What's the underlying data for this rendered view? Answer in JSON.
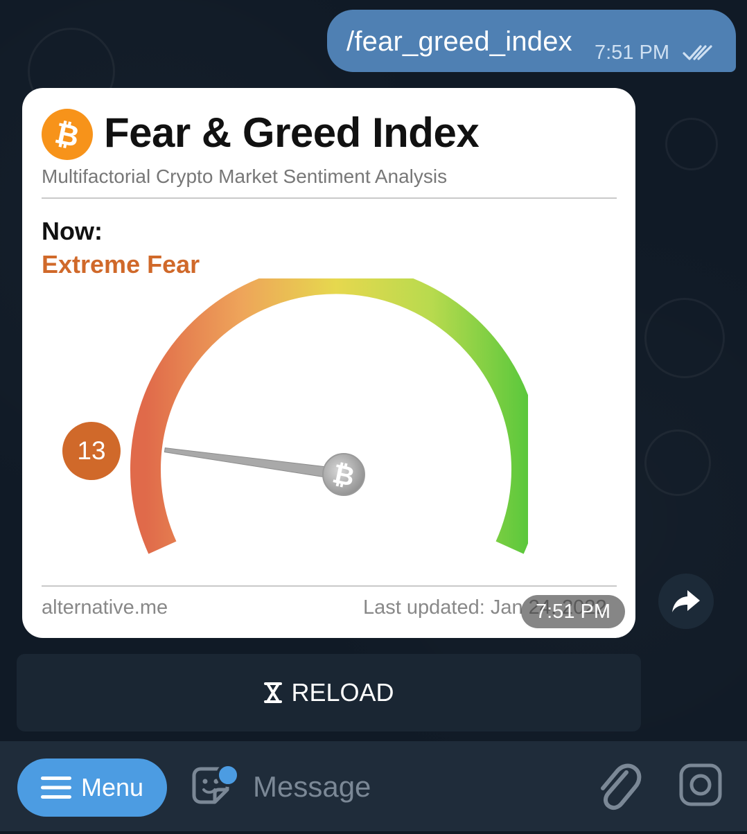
{
  "messages": {
    "outgoing": {
      "text": "/fear_greed_index",
      "time": "7:51 PM"
    },
    "incoming_image": {
      "title": "Fear & Greed Index",
      "subtitle": "Multifactorial Crypto Market Sentiment Analysis",
      "now_label": "Now:",
      "now_value": "Extreme Fear",
      "index_value": "13",
      "index_fraction": 0.13,
      "source": "alternative.me",
      "last_updated": "Last updated: Jan 24, 2022",
      "time": "7:51 PM",
      "colors": {
        "fear": "#d0692a",
        "greed": "#5cc83c",
        "neutral": "#e2d84a"
      }
    }
  },
  "inline_keyboard": {
    "reload_icon": "hourglass-icon",
    "reload_label": "RELOAD"
  },
  "input_bar": {
    "menu_label": "Menu",
    "message_placeholder": "Message"
  },
  "icons": {
    "forward": "forward-arrow-icon",
    "attach": "paperclip-icon",
    "camera": "camera-icon",
    "sticker": "sticker-icon"
  },
  "theme": {
    "accent": "#4c9ce2",
    "bubble_out": "#4f80b3",
    "background": "#101a26"
  }
}
